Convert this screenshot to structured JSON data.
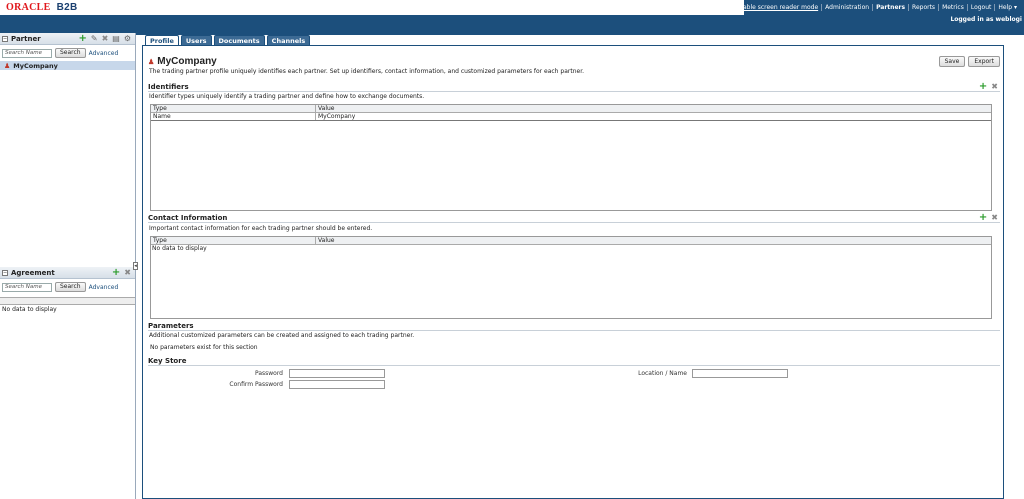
{
  "app": {
    "oracle": "ORACLE",
    "product": "B2B"
  },
  "globalnav": {
    "screen_reader": "Enable screen reader mode",
    "administration": "Administration",
    "partners": "Partners",
    "reports": "Reports",
    "metrics": "Metrics",
    "logout": "Logout",
    "help": "Help ▾"
  },
  "loggedin": "Logged in as weblogi",
  "partner_panel": {
    "title": "Partner",
    "search_placeholder": "Search Name",
    "search_button": "Search",
    "advanced": "Advanced",
    "items": [
      {
        "label": "MyCompany"
      }
    ]
  },
  "agreement_panel": {
    "title": "Agreement",
    "search_placeholder": "Search Name",
    "search_button": "Search",
    "advanced": "Advanced",
    "nodata": "No data to display"
  },
  "tabs": [
    "Profile",
    "Users",
    "Documents",
    "Channels"
  ],
  "profile": {
    "name": "MyCompany",
    "description": "The trading partner profile uniquely identifies each partner. Set up identifiers, contact information, and customized parameters for each partner.",
    "save": "Save",
    "export": "Export"
  },
  "identifiers": {
    "title": "Identifiers",
    "description": "Identifier types uniquely identify a trading partner and define how to exchange documents.",
    "columns": [
      "Type",
      "Value"
    ],
    "rows": [
      {
        "type": "Name",
        "value": "MyCompany"
      }
    ]
  },
  "contact": {
    "title": "Contact Information",
    "description": "Important contact information for each trading partner should be entered.",
    "columns": [
      "Type",
      "Value"
    ],
    "nodata": "No data to display"
  },
  "parameters": {
    "title": "Parameters",
    "description": "Additional customized parameters can be created and assigned to each trading partner.",
    "empty": "No parameters exist for this section"
  },
  "keystore": {
    "title": "Key Store",
    "password_label": "Password",
    "confirm_label": "Confirm Password",
    "location_label": "Location / Name"
  }
}
